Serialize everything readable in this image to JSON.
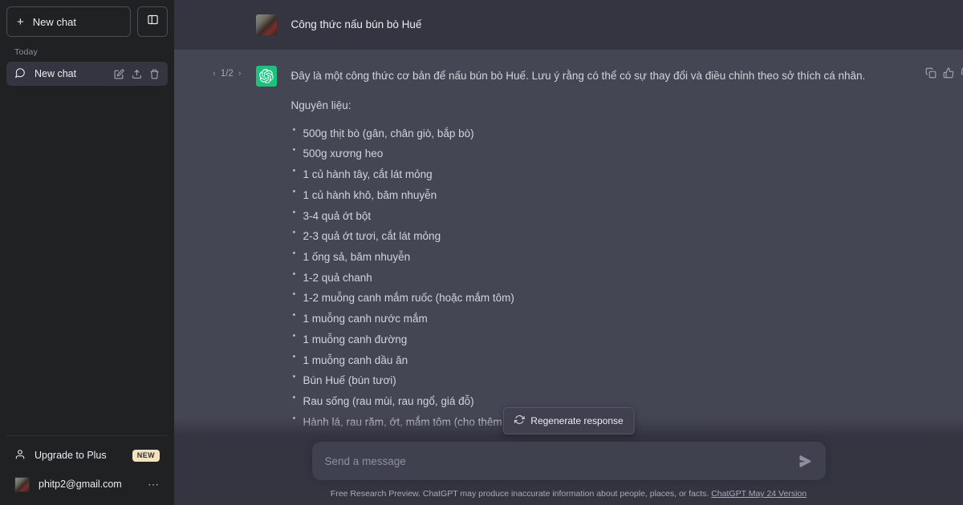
{
  "sidebar": {
    "new_chat_label": "New chat",
    "plus_icon": "+",
    "panel_toggle_icon": "sidebar-toggle-icon",
    "section_label": "Today",
    "chat_items": [
      {
        "label": "New chat",
        "icon": "chat-bubble-icon",
        "actions": [
          "edit-icon",
          "share-icon",
          "trash-icon"
        ]
      }
    ],
    "upgrade": {
      "label": "Upgrade to Plus",
      "badge": "NEW",
      "badge_color": "#f6e2ba",
      "icon": "person-icon"
    },
    "account": {
      "label": "phitp2@gmail.com",
      "menu_icon": "ellipsis-icon"
    },
    "background_color": "#202123",
    "active_item_color": "#343541"
  },
  "conversation": {
    "user_message": {
      "text": "Công thức nấu bún bò Huế",
      "avatar": "user-photo-avatar"
    },
    "assistant_message": {
      "pager": {
        "prev": "‹",
        "current": "1/2",
        "next": "›"
      },
      "avatar": "chatgpt-logo-icon",
      "avatar_color": "#19c37d",
      "intro": "Đây là một công thức cơ bản để nấu bún bò Huế. Lưu ý rằng có thể có sự thay đổi và điều chỉnh theo sở thích cá nhân.",
      "section_heading": "Nguyên liệu:",
      "ingredients": [
        "500g thịt bò (gân, chân giò, bắp bò)",
        "500g xương heo",
        "1 củ hành tây, cắt lát mỏng",
        "1 củ hành khô, băm nhuyễn",
        "3-4 quả ớt bột",
        "2-3 quả ớt tươi, cắt lát mỏng",
        "1 ống sả, băm nhuyễn",
        "1-2 quả chanh",
        "1-2 muỗng canh mắm ruốc (hoặc mắm tôm)",
        "1 muỗng canh nước mắm",
        "1 muỗng canh đường",
        "1 muỗng canh dầu ăn",
        "Bún Huế (bún tươi)",
        "Rau sống (rau mùi, rau ngổ, giá đỗ)",
        "Hành lá, rau răm, ớt, mắm tôm (cho thêm hương vị)"
      ],
      "tools": [
        "copy-icon",
        "thumbs-up-icon",
        "thumbs-down-icon"
      ]
    },
    "assistant_background": "#444654",
    "user_background": "#343541"
  },
  "composer": {
    "placeholder": "Send a message",
    "value": "",
    "send_icon": "send-arrow-icon",
    "regenerate_label": "Regenerate response",
    "regenerate_icon": "refresh-icon"
  },
  "footer": {
    "disclaimer": "Free Research Preview. ChatGPT may produce inaccurate information about people, places, or facts.",
    "version_link": "ChatGPT May 24 Version"
  }
}
